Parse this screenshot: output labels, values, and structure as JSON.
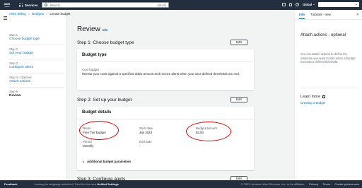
{
  "topnav": {
    "services_label": "Services",
    "search_placeholder": "Search",
    "search_shortcut": "[Alt+S]",
    "region_label": "Global"
  },
  "breadcrumb": {
    "items": [
      "AWS Billing",
      "Budgets",
      "Create budget"
    ]
  },
  "steps": [
    {
      "num": "Step 1",
      "name": "Choose budget type"
    },
    {
      "num": "Step 2",
      "name": "Set your budget"
    },
    {
      "num": "Step 3",
      "name": "Configure alerts"
    },
    {
      "num": "Step 4 - Optional",
      "name": "Attach actions"
    },
    {
      "num": "Step 5",
      "name": "Review"
    }
  ],
  "page": {
    "title": "Review",
    "info_label": "Info"
  },
  "step1": {
    "heading": "Step 1: Choose budget type",
    "edit_label": "Edit",
    "card_title": "Budget type",
    "type_label": "Cost budget",
    "type_description": "Monitor your costs against a specified dollar amount and receive alerts when your user-defined thresholds are met."
  },
  "step2": {
    "heading": "Step 2: Set up your budget",
    "edit_label": "Edit",
    "card_title": "Budget details",
    "name_label": "Name",
    "name_value": "Free Tier Budget",
    "start_label": "Start date",
    "start_value": "Jan 2023",
    "amount_label": "Budget amount",
    "amount_value": "$3.00",
    "period_label": "Period",
    "period_value": "Monthly",
    "end_label": "End date",
    "end_value": "-",
    "additional_label": "Additional budget parameters"
  },
  "step3": {
    "heading": "Step 3: Configure alerts",
    "edit_label": "Edit"
  },
  "help_panel": {
    "tab_info": "Info",
    "tab_tutorials": "Tutorials - new",
    "title": "Attach actions - optional",
    "description": "You can attach actions to define the response you want to take when a budget exceeds a defined threshold.",
    "learn_more": "Learn more",
    "link": "Creating a Budget"
  },
  "footer": {
    "feedback": "Feedback",
    "language_prompt": "Looking for language selection? Find it in the new",
    "unified_settings": "Unified Settings",
    "copyright": "© 2023, Amazon Web Services, Inc. or its affiliates.",
    "privacy": "Privacy",
    "terms": "Terms",
    "cookie": "Cookie preferences"
  },
  "colors": {
    "nav_bg": "#232f3e",
    "link": "#0073bb",
    "annotation_circle": "#e00000",
    "logo_accent": "#ff9900"
  }
}
